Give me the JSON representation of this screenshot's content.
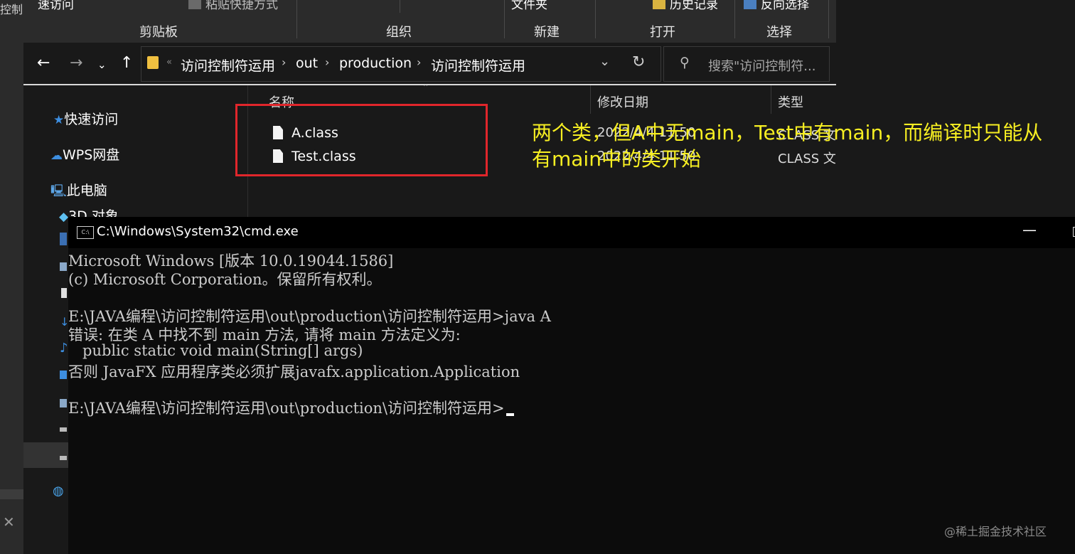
{
  "background_window": {
    "tag_text": "控制"
  },
  "explorer": {
    "ribbon": {
      "top_items": [
        "速访问",
        "粘贴快捷方式",
        "文件夹",
        "历史记录",
        "反向选择"
      ],
      "groups": [
        "剪贴板",
        "组织",
        "新建",
        "打开",
        "选择"
      ]
    },
    "address": {
      "overflow": "«",
      "crumbs": [
        "访问控制符运用",
        "out",
        "production",
        "访问控制符运用"
      ],
      "search_placeholder": "搜索\"访问控制符..."
    },
    "nav": {
      "items": [
        "快速访问",
        "WPS网盘",
        "此电脑",
        "3D 对象"
      ]
    },
    "columns": {
      "name": "名称",
      "modified": "修改日期",
      "type": "类型"
    },
    "files": [
      {
        "name": "A.class",
        "modified": "2022/4/4 11:50",
        "type": "CLASS 文"
      },
      {
        "name": "Test.class",
        "modified": "2022/4/4 11:50",
        "type": "CLASS 文"
      }
    ]
  },
  "annotation": {
    "line1": "两个类，但A中无main，Test中有main，而编译时只能从",
    "line2": "有main中的类开始"
  },
  "cmd": {
    "title": "C:\\Windows\\System32\\cmd.exe",
    "lines": [
      "Microsoft Windows [版本 10.0.19044.1586]",
      "(c) Microsoft Corporation。保留所有权利。",
      "",
      "E:\\JAVA编程\\访问控制符运用\\out\\production\\访问控制符运用>java A",
      "错误: 在类 A 中找不到 main 方法, 请将 main 方法定义为:",
      "   public static void main(String[] args)",
      "否则 JavaFX 应用程序类必须扩展javafx.application.Application",
      "",
      "E:\\JAVA编程\\访问控制符运用\\out\\production\\访问控制符运用>"
    ]
  },
  "watermark": "@稀土掘金技术社区",
  "colors": {
    "annotation": "#f7ef22",
    "highlight_box": "#e0262b",
    "cmd_bg": "#0c0c0c"
  }
}
